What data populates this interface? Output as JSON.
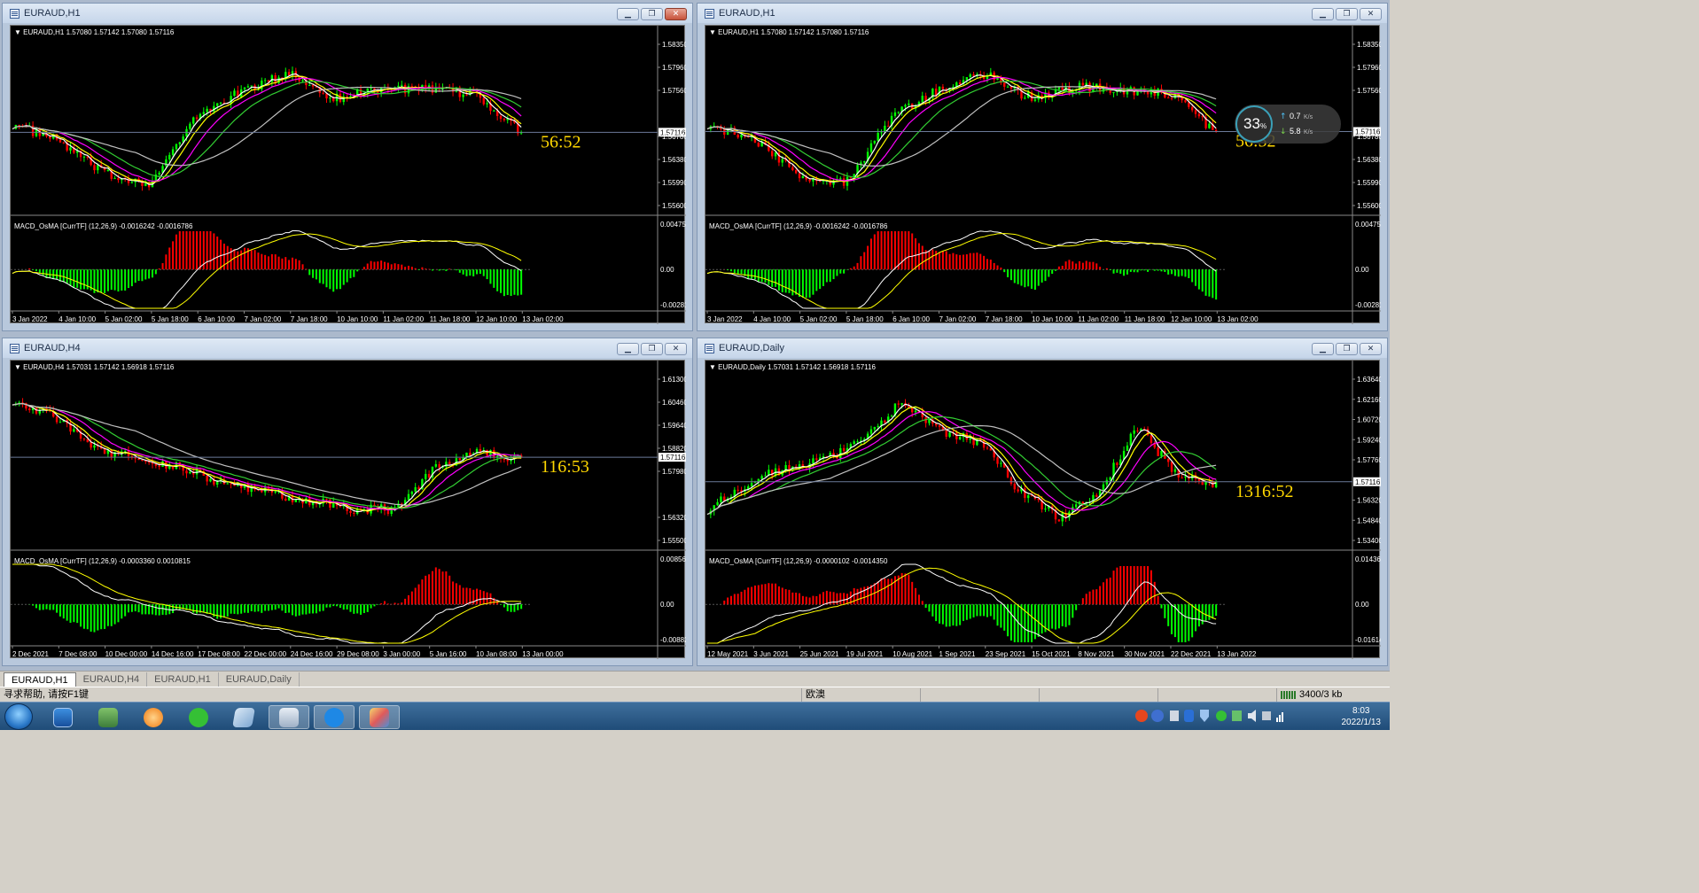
{
  "windows": [
    {
      "title": "EURAUD,H1",
      "info": "EURAUD,H1  1.57080 1.57142 1.57080 1.57116",
      "timer": "56:52",
      "macd_label": "MACD_OsMA [CurrTF] (12,26,9) -0.0016242 -0.0016786",
      "price_levels": [
        "1.58350",
        "1.57960",
        "1.57560",
        "1.57116",
        "1.56780",
        "1.56380",
        "1.55990",
        "1.55600"
      ],
      "macd_levels": [
        "0.0047546",
        "0.00",
        "-0.002813"
      ],
      "time_labels": [
        "3 Jan 2022",
        "4 Jan 10:00",
        "5 Jan 02:00",
        "5 Jan 18:00",
        "6 Jan 10:00",
        "7 Jan 02:00",
        "7 Jan 18:00",
        "10 Jan 10:00",
        "11 Jan 02:00",
        "11 Jan 18:00",
        "12 Jan 10:00",
        "13 Jan 02:00"
      ],
      "close_red": true
    },
    {
      "title": "EURAUD,H1",
      "info": "EURAUD,H1  1.57080 1.57142 1.57080 1.57116",
      "timer": "56:52",
      "macd_label": "MACD_OsMA [CurrTF] (12,26,9) -0.0016242 -0.0016786",
      "price_levels": [
        "1.58350",
        "1.57960",
        "1.57560",
        "1.57116",
        "1.56780",
        "1.56380",
        "1.55990",
        "1.55600"
      ],
      "macd_levels": [
        "0.0047546",
        "0.00",
        "-0.002813"
      ],
      "time_labels": [
        "3 Jan 2022",
        "4 Jan 10:00",
        "5 Jan 02:00",
        "5 Jan 18:00",
        "6 Jan 10:00",
        "7 Jan 02:00",
        "7 Jan 18:00",
        "10 Jan 10:00",
        "11 Jan 02:00",
        "11 Jan 18:00",
        "12 Jan 10:00",
        "13 Jan 02:00"
      ],
      "close_red": false
    },
    {
      "title": "EURAUD,H4",
      "info": "EURAUD,H4  1.57031 1.57142 1.56918 1.57116",
      "timer": "116:53",
      "macd_label": "MACD_OsMA [CurrTF] (12,26,9) -0.0003360 0.0010815",
      "price_levels": [
        "1.61300",
        "1.60460",
        "1.59640",
        "1.58820",
        "1.57980",
        "1.57116",
        "1.56320",
        "1.55500"
      ],
      "macd_levels": [
        "0.0085675",
        "0.00",
        "-0.008829"
      ],
      "time_labels": [
        "2 Dec 2021",
        "7 Dec 08:00",
        "10 Dec 00:00",
        "14 Dec 16:00",
        "17 Dec 08:00",
        "22 Dec 00:00",
        "24 Dec 16:00",
        "29 Dec 08:00",
        "3 Jan 00:00",
        "5 Jan 16:00",
        "10 Jan 08:00",
        "13 Jan 00:00"
      ],
      "close_red": false
    },
    {
      "title": "EURAUD,Daily",
      "info": "EURAUD,Daily  1.57031 1.57142 1.56918 1.57116",
      "timer": "1316:52",
      "macd_label": "MACD_OsMA [CurrTF] (12,26,9) -0.0000102 -0.0014350",
      "price_levels": [
        "1.63640",
        "1.62160",
        "1.60720",
        "1.59240",
        "1.57760",
        "1.57116",
        "1.56320",
        "1.54840",
        "1.53400"
      ],
      "macd_levels": [
        "0.0143607",
        "0.00",
        "-0.016144"
      ],
      "time_labels": [
        "12 May 2021",
        "3 Jun 2021",
        "25 Jun 2021",
        "19 Jul 2021",
        "10 Aug 2021",
        "1 Sep 2021",
        "23 Sep 2021",
        "15 Oct 2021",
        "8 Nov 2021",
        "30 Nov 2021",
        "22 Dec 2021",
        "13 Jan 2022"
      ],
      "close_red": false
    }
  ],
  "net_widget": {
    "percent": "33",
    "percent_sign": "%",
    "up": "0.7",
    "down": "5.8",
    "unit": "K/s"
  },
  "tabs": [
    "EURAUD,H1",
    "EURAUD,H4",
    "EURAUD,H1",
    "EURAUD,Daily"
  ],
  "status": {
    "help": "寻求帮助, 请按F1键",
    "profile": "欧澳",
    "traffic": "3400/3 kb"
  },
  "clock": {
    "time": "8:03",
    "date": "2022/1/13"
  },
  "taskbar_items": [
    "start",
    "desktop",
    "network",
    "browser",
    "wechat",
    "notes",
    "mt4",
    "pen",
    "paint"
  ],
  "colors": {
    "bull": "#00ff00",
    "bear": "#ff0000",
    "ma_white": "#ffffff",
    "ma_yellow": "#ffff00",
    "ma_magenta": "#ff00ff",
    "ma_green": "#32cd32",
    "ma_silver": "#c0c0c0",
    "timer": "#ffd700"
  }
}
